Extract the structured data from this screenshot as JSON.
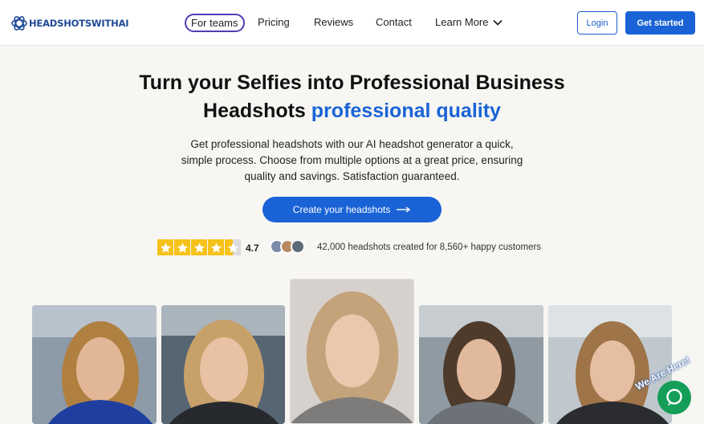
{
  "brand": {
    "name": "HEADSHOTSWITHAI",
    "color": "#1a63d6"
  },
  "nav": {
    "teams": "For teams",
    "pricing": "Pricing",
    "reviews": "Reviews",
    "contact": "Contact",
    "learn_more": "Learn More",
    "login": "Login",
    "get_started": "Get started"
  },
  "hero": {
    "title_line1": "Turn your Selfies into Professional Business",
    "title_line2_plain": "Headshots ",
    "title_line2_accent": "professional quality",
    "subtitle": "Get professional headshots with our AI headshot generator a quick, simple process. Choose from multiple options at a great price, ensuring quality and savings. Satisfaction guaranteed.",
    "cta": "Create your headshots"
  },
  "rating": {
    "score": "4.7",
    "stars_filled": 4.5,
    "customers_text": "42,000 headshots created for 8,560+ happy customers"
  },
  "chat": {
    "badge": "We Are Here!",
    "color": "#149e58"
  },
  "icons": [
    "openai-logo-icon",
    "chevron-down-icon",
    "arrow-right-icon",
    "star-icon",
    "chat-bubble-icon"
  ]
}
